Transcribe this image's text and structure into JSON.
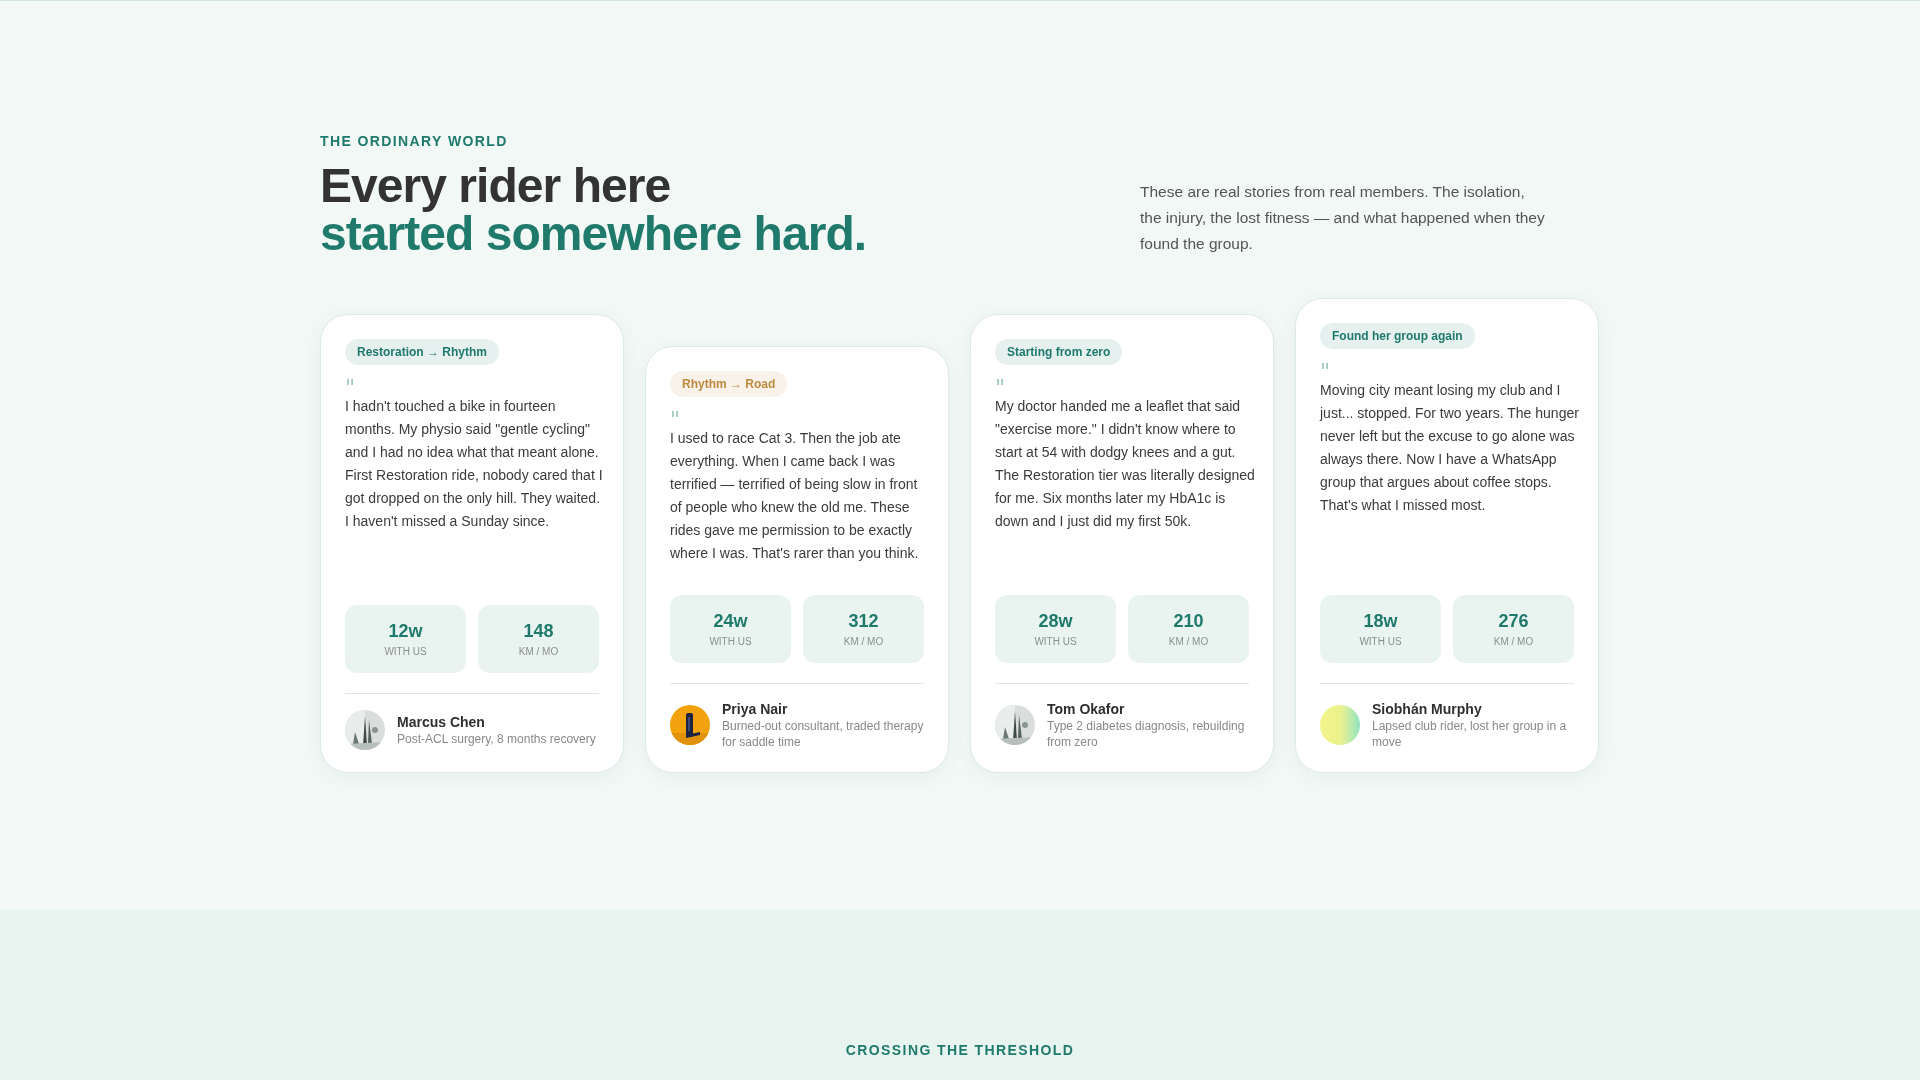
{
  "intro": {
    "eyebrow": "THE ORDINARY WORLD",
    "title_line_1": "Every rider here",
    "title_line_2": "started somewhere hard.",
    "description": "These are real stories from real members. The isolation, the injury, the lost fitness — and what happened when they found the group."
  },
  "stories": [
    {
      "tag": "Restoration → Rhythm",
      "color": "#1f7a6c",
      "quote_mark": "\"",
      "quote": "I hadn't touched a bike in fourteen months. My physio said \"gentle cycling\" and I had no idea what that meant alone. First Restoration ride, nobody cared that I got dropped on the only hill. They waited. I haven't missed a Sunday since.",
      "stats": [
        {
          "value": "12w",
          "label": "WITH US"
        },
        {
          "value": "148",
          "label": "KM / MO"
        }
      ],
      "name": "Marcus Chen",
      "detail": "Post-ACL surgery, 8 months recovery"
    },
    {
      "tag": "Rhythm → Road",
      "color": "#c08a3e",
      "quote_mark": "\"",
      "quote": "I used to race Cat 3. Then the job ate everything. When I came back I was terrified — terrified of being slow in front of people who knew the old me. These rides gave me permission to be exactly where I was. That's rarer than you think.",
      "stats": [
        {
          "value": "24w",
          "label": "WITH US"
        },
        {
          "value": "312",
          "label": "KM / MO"
        }
      ],
      "name": "Priya Nair",
      "detail": "Burned-out consultant, traded therapy for saddle time"
    },
    {
      "tag": "Starting from zero",
      "color": "#1f7a6c",
      "quote_mark": "\"",
      "quote": "My doctor handed me a leaflet that said \"exercise more.\" I didn't know where to start at 54 with dodgy knees and a gut. The Restoration tier was literally designed for me. Six months later my HbA1c is down and I just did my first 50k.",
      "stats": [
        {
          "value": "28w",
          "label": "WITH US"
        },
        {
          "value": "210",
          "label": "KM / MO"
        }
      ],
      "name": "Tom Okafor",
      "detail": "Type 2 diabetes diagnosis, rebuilding from zero"
    },
    {
      "tag": "Found her group again",
      "color": "#1f7a6c",
      "quote_mark": "\"",
      "quote": "Moving city meant losing my club and I just... stopped. For two years. The hunger never left but the excuse to go alone was always there. Now I have a WhatsApp group that argues about coffee stops. That's what I missed most.",
      "stats": [
        {
          "value": "18w",
          "label": "WITH US"
        },
        {
          "value": "276",
          "label": "KM / MO"
        }
      ],
      "name": "Siobhán Murphy",
      "detail": "Lapsed club rider, lost her group in a move",
      "avatar": {
        "kind": "gradient"
      }
    }
  ],
  "next_section": {
    "eyebrow": "CROSSING THE THRESHOLD"
  }
}
